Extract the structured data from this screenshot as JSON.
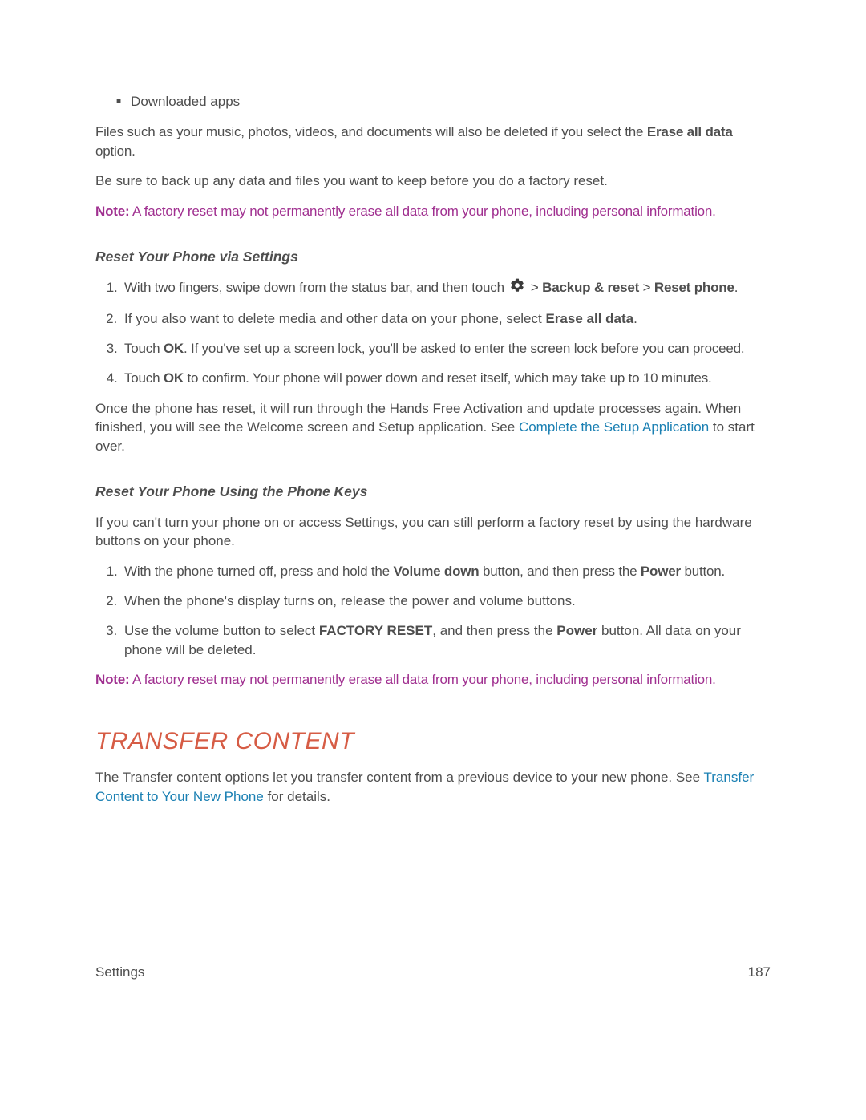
{
  "bullet_item": "Downloaded apps",
  "intro_files": {
    "p1_a": "Files such as your music, photos, videos, and documents will also be deleted if you select the ",
    "p1_bold": "Erase all data",
    "p1_b": " option."
  },
  "backup_warning": "Be sure to back up any data and files you want to keep before you do a factory reset.",
  "note1": {
    "label": "Note:",
    "text": "  A factory reset may not permanently erase all data from your phone, including personal information."
  },
  "sub1_title": "Reset Your Phone via Settings",
  "steps1": {
    "s1_a": "With two fingers, swipe down from the status bar, and then touch ",
    "s1_sep1": " > ",
    "s1_b1": "Backup & reset",
    "s1_sep2": " > ",
    "s1_b2": "Reset phone",
    "s1_end": ".",
    "s2_a": "If you also want to delete media and other data on your phone, select ",
    "s2_b": "Erase all data",
    "s2_c": ".",
    "s3_a": "Touch ",
    "s3_b": "OK",
    "s3_c": ". If you've set up a screen lock, you'll be asked to enter the screen lock before you can proceed.",
    "s4_a": "Touch ",
    "s4_b": "OK",
    "s4_c": " to confirm. Your phone will power down and reset itself, which may take up to 10 minutes."
  },
  "after_reset": {
    "a": "Once the phone has reset, it will run through the Hands Free Activation and update processes again. When finished, you will see the Welcome screen and Setup application. See ",
    "link": "Complete the Setup Application",
    "b": " to start over."
  },
  "sub2_title": "Reset Your Phone Using the Phone Keys",
  "sub2_intro": "If you can't turn your phone on or access Settings, you can still perform a factory reset by using the hardware buttons on your phone.",
  "steps2": {
    "s1_a": "With the phone turned off, press and hold the ",
    "s1_b": "Volume down",
    "s1_c": " button, and then press the ",
    "s1_d": "Power",
    "s1_e": " button.",
    "s2": "When the phone's display turns on, release the power and volume buttons.",
    "s3_a": "Use the volume button to select ",
    "s3_b": "FACTORY RESET",
    "s3_c": ", and then press the ",
    "s3_d": "Power",
    "s3_e": " button. All data on your phone will be deleted."
  },
  "note2": {
    "label": "Note:",
    "text": "  A factory reset may not permanently erase all data from your phone, including personal information."
  },
  "transfer": {
    "title": "TRANSFER CONTENT",
    "p_a": "The Transfer content options let you transfer content from a previous device to your new phone. See ",
    "link": "Transfer Content to Your New Phone",
    "p_b": " for details."
  },
  "footer": {
    "left": "Settings",
    "right": "187"
  }
}
